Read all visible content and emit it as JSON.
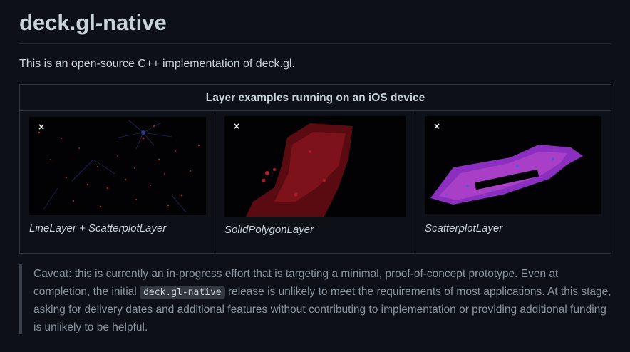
{
  "heading": "deck.gl-native",
  "intro": "This is an open-source C++ implementation of deck.gl.",
  "table": {
    "header": "Layer examples running on an iOS device",
    "cells": [
      {
        "caption": "LineLayer + ScatterplotLayer",
        "image_icon": "broken-image-x-icon",
        "image_glyph": "×"
      },
      {
        "caption": "SolidPolygonLayer",
        "image_icon": "broken-image-x-icon",
        "image_glyph": "×"
      },
      {
        "caption": "ScatterplotLayer",
        "image_icon": "broken-image-x-icon",
        "image_glyph": "×"
      }
    ]
  },
  "caveat": {
    "before": "Caveat: this is currently an in-progress effort that is targeting a minimal, proof-of-concept prototype. Even at completion, the initial ",
    "code": "deck.gl-native",
    "after": " release is unlikely to meet the requirements of most applications. At this stage, asking for delivery dates and additional features without contributing to implementation or providing additional funding is unlikely to be helpful."
  },
  "colors": {
    "background": "#0d1117",
    "text": "#c9d1d9",
    "muted_text": "#8b949e",
    "border": "#30363d"
  }
}
